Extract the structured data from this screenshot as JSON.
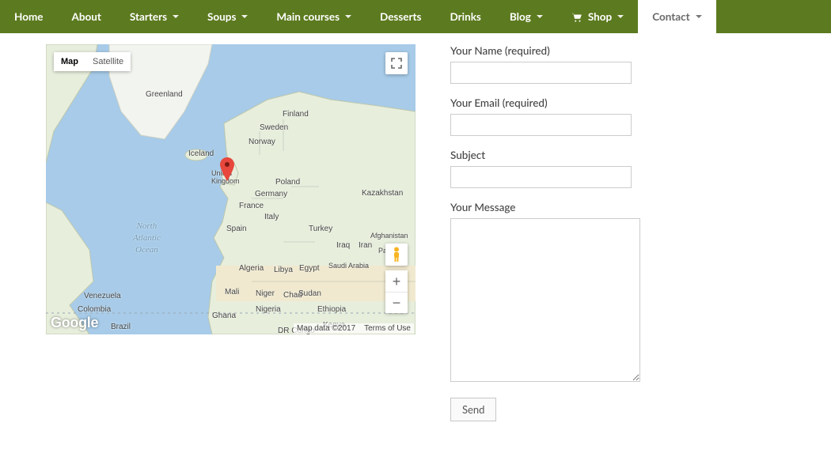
{
  "nav": {
    "items": [
      {
        "label": "Home",
        "dropdown": false,
        "cart": false,
        "active": false
      },
      {
        "label": "About",
        "dropdown": false,
        "cart": false,
        "active": false
      },
      {
        "label": "Starters",
        "dropdown": true,
        "cart": false,
        "active": false
      },
      {
        "label": "Soups",
        "dropdown": true,
        "cart": false,
        "active": false
      },
      {
        "label": "Main courses",
        "dropdown": true,
        "cart": false,
        "active": false
      },
      {
        "label": "Desserts",
        "dropdown": false,
        "cart": false,
        "active": false
      },
      {
        "label": "Drinks",
        "dropdown": false,
        "cart": false,
        "active": false
      },
      {
        "label": "Blog",
        "dropdown": true,
        "cart": false,
        "active": false
      },
      {
        "label": "Shop",
        "dropdown": true,
        "cart": true,
        "active": false
      },
      {
        "label": "Contact",
        "dropdown": true,
        "cart": false,
        "active": true
      }
    ]
  },
  "map": {
    "maptype": {
      "map": "Map",
      "satellite": "Satellite",
      "selected": "map"
    },
    "zoom": {
      "in": "+",
      "out": "−"
    },
    "attribution": {
      "data": "Map data ©2017",
      "terms": "Terms of Use"
    },
    "logo": "Google",
    "labels": {
      "greenland": "Greenland",
      "iceland": "Iceland",
      "norway": "Norway",
      "sweden": "Sweden",
      "finland": "Finland",
      "uk": "United Kingdom",
      "germany": "Germany",
      "poland": "Poland",
      "france": "France",
      "spain": "Spain",
      "italy": "Italy",
      "turkey": "Turkey",
      "egypt": "Egypt",
      "libya": "Libya",
      "algeria": "Algeria",
      "mali": "Mali",
      "niger": "Niger",
      "chad": "Chad",
      "sudan": "Sudan",
      "nigeria": "Nigeria",
      "ethiopia": "Ethiopia",
      "kenya": "Kenya",
      "drcongo": "DR Congo",
      "ghana": "Ghana",
      "saudi": "Saudi Arabia",
      "iraq": "Iraq",
      "iran": "Iran",
      "afghanistan": "Afghanistan",
      "pakistan": "Pakistan",
      "kazakhstan": "Kazakhstan",
      "venezuela": "Venezuela",
      "colombia": "Colombia",
      "brazil": "Brazil",
      "ocean": "North\nAtlantic\nOcean"
    }
  },
  "form": {
    "name_label": "Your Name (required)",
    "email_label": "Your Email (required)",
    "subject_label": "Subject",
    "message_label": "Your Message",
    "send_label": "Send",
    "name_value": "",
    "email_value": "",
    "subject_value": "",
    "message_value": ""
  },
  "colors": {
    "nav_bg": "#5c7a1f",
    "nav_text": "#ffffff",
    "active_bg": "#ffffff"
  }
}
